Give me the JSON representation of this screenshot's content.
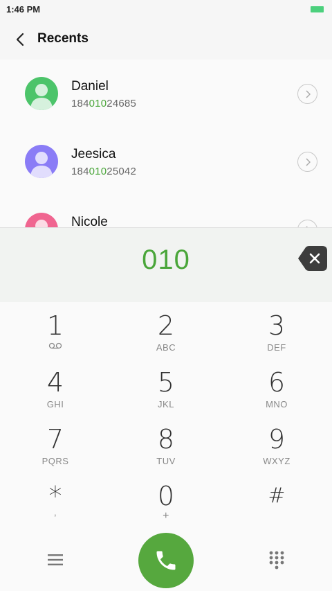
{
  "status": {
    "time": "1:46 PM",
    "battery_color": "#4cd07d"
  },
  "header": {
    "title": "Recents"
  },
  "recents": [
    {
      "name": "Daniel",
      "number_pre": "184",
      "number_match": "010",
      "number_post": "24685",
      "avatar_color": "#4cc46a",
      "avatar_light": "#d6f1dd"
    },
    {
      "name": "Jeesica",
      "number_pre": "184",
      "number_match": "010",
      "number_post": "25042",
      "avatar_color": "#8a7cf6",
      "avatar_light": "#e1ddfd"
    },
    {
      "name": "Nicole",
      "number_pre": "",
      "number_match": "",
      "number_post": "",
      "avatar_color": "#f06590",
      "avatar_light": "#fcdbe5"
    }
  ],
  "entry": {
    "dialed": "010"
  },
  "keypad": [
    {
      "digit": "1",
      "letters": ""
    },
    {
      "digit": "2",
      "letters": "ABC"
    },
    {
      "digit": "3",
      "letters": "DEF"
    },
    {
      "digit": "4",
      "letters": "GHI"
    },
    {
      "digit": "5",
      "letters": "JKL"
    },
    {
      "digit": "6",
      "letters": "MNO"
    },
    {
      "digit": "7",
      "letters": "PQRS"
    },
    {
      "digit": "8",
      "letters": "TUV"
    },
    {
      "digit": "9",
      "letters": "WXYZ"
    },
    {
      "digit": "*",
      "letters": ","
    },
    {
      "digit": "0",
      "letters": "+"
    },
    {
      "digit": "#",
      "letters": ""
    }
  ],
  "colors": {
    "accent": "#4aa63a",
    "call": "#56a83e"
  }
}
